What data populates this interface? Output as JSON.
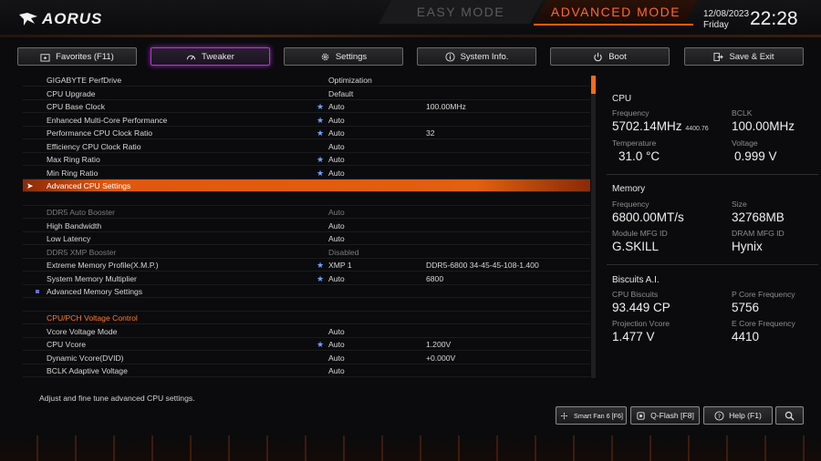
{
  "header": {
    "brand": "AORUS",
    "easy_mode": "EASY MODE",
    "advanced_mode": "ADVANCED MODE",
    "date": "12/08/2023",
    "day": "Friday",
    "time": "22:28"
  },
  "tabs": [
    {
      "label": "Favorites (F11)",
      "icon": "folder-star-icon"
    },
    {
      "label": "Tweaker",
      "icon": "gauge-icon",
      "active": true
    },
    {
      "label": "Settings",
      "icon": "gear-icon"
    },
    {
      "label": "System Info.",
      "icon": "info-icon"
    },
    {
      "label": "Boot",
      "icon": "power-icon"
    },
    {
      "label": "Save & Exit",
      "icon": "exit-icon"
    }
  ],
  "settings": [
    {
      "name": "GIGABYTE PerfDrive",
      "value": "Optimization",
      "extra": "",
      "star": false
    },
    {
      "name": "CPU Upgrade",
      "value": "Default",
      "extra": "",
      "star": false
    },
    {
      "name": "CPU Base Clock",
      "value": "Auto",
      "extra": "100.00MHz",
      "star": true
    },
    {
      "name": "Enhanced Multi-Core Performance",
      "value": "Auto",
      "extra": "",
      "star": true
    },
    {
      "name": "Performance CPU Clock Ratio",
      "value": "Auto",
      "extra": "32",
      "star": true
    },
    {
      "name": "Efficiency CPU Clock Ratio",
      "value": "Auto",
      "extra": "",
      "star": false
    },
    {
      "name": "Max Ring Ratio",
      "value": "Auto",
      "extra": "",
      "star": true
    },
    {
      "name": "Min Ring Ratio",
      "value": "Auto",
      "extra": "",
      "star": true
    },
    {
      "name": "Advanced CPU Settings",
      "value": "",
      "extra": "",
      "star": false
    },
    {
      "name": "",
      "value": "",
      "extra": "",
      "star": false
    },
    {
      "name": "DDR5 Auto Booster",
      "value": "Auto",
      "extra": "",
      "star": false
    },
    {
      "name": "High Bandwidth",
      "value": "Auto",
      "extra": "",
      "star": false
    },
    {
      "name": "Low Latency",
      "value": "Auto",
      "extra": "",
      "star": false
    },
    {
      "name": "DDR5 XMP Booster",
      "value": "Disabled",
      "extra": "",
      "star": false
    },
    {
      "name": "Extreme Memory Profile(X.M.P.)",
      "value": "XMP 1",
      "extra": "DDR5-6800 34-45-45-108-1.400",
      "star": true
    },
    {
      "name": "System Memory Multiplier",
      "value": "Auto",
      "extra": "6800",
      "star": true
    },
    {
      "name": "Advanced Memory Settings",
      "value": "",
      "extra": "",
      "star": false
    },
    {
      "name": "",
      "value": "",
      "extra": "",
      "star": false
    },
    {
      "name": "CPU/PCH Voltage Control",
      "value": "",
      "extra": "",
      "star": false
    },
    {
      "name": "Vcore Voltage Mode",
      "value": "Auto",
      "extra": "",
      "star": false
    },
    {
      "name": "CPU Vcore",
      "value": "Auto",
      "extra": "1.200V",
      "star": true
    },
    {
      "name": "Dynamic Vcore(DVID)",
      "value": "Auto",
      "extra": "+0.000V",
      "star": false
    },
    {
      "name": "BCLK Adaptive Voltage",
      "value": "Auto",
      "extra": "",
      "star": false
    }
  ],
  "info": {
    "cpu": {
      "title": "CPU",
      "frequency_label": "Frequency",
      "frequency": "5702.14MHz",
      "frequency_sub": "4400.76",
      "bclk_label": "BCLK",
      "bclk": "100.00MHz",
      "temp_label": "Temperature",
      "temp": "31.0 °C",
      "voltage_label": "Voltage",
      "voltage": "0.999 V"
    },
    "memory": {
      "title": "Memory",
      "frequency_label": "Frequency",
      "frequency": "6800.00MT/s",
      "size_label": "Size",
      "size": "32768MB",
      "module_label": "Module MFG ID",
      "module": "G.SKILL",
      "dram_label": "DRAM MFG ID",
      "dram": "Hynix"
    },
    "biscuits": {
      "title": "Biscuits A.I.",
      "cpu_label": "CPU Biscuits",
      "cpu": "93.449 CP",
      "pcore_label": "P Core Frequency",
      "pcore": "5756",
      "vcore_label": "Projection Vcore",
      "vcore": "1.477 V",
      "ecore_label": "E Core Frequency",
      "ecore": "4410"
    }
  },
  "footer": {
    "help_text": "Adjust and fine tune advanced CPU settings.",
    "smart_fan": "Smart Fan 6 [F6]",
    "qflash": "Q-Flash [F8]",
    "help": "Help (F1)"
  },
  "colors": {
    "accent": "#ff6a1a",
    "tab_active": "#b23ad0",
    "star": "#6aa6ff"
  }
}
